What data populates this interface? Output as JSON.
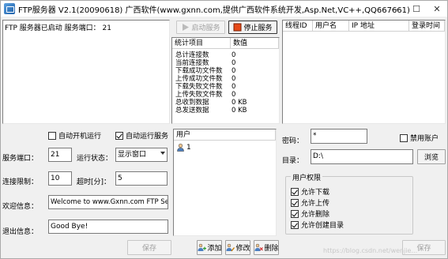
{
  "window": {
    "title": "FTP服务器 V2.1(20090618) 广西软件(www.gxnn.com,提供广西软件系统开发,Asp.Net,VC++,QQ667661)",
    "minimize": "—",
    "maximize": "☐",
    "close": "✕"
  },
  "log": {
    "text": "FTP 服务器已启动 服务端口： 21"
  },
  "toolbar": {
    "start_label": "启动服务",
    "stop_label": "停止服务"
  },
  "stats": {
    "header_item": "统计项目",
    "header_value": "数值",
    "rows": [
      {
        "key": "总计连接数",
        "value": "0"
      },
      {
        "key": "当前连接数",
        "value": "0"
      },
      {
        "key": "下载成功文件数",
        "value": "0"
      },
      {
        "key": "上传成功文件数",
        "value": "0"
      },
      {
        "key": "下载失败文件数",
        "value": "0"
      },
      {
        "key": "上传失败文件数",
        "value": "0"
      },
      {
        "key": "总收到数据",
        "value": "0 KB"
      },
      {
        "key": "总发送数据",
        "value": "0 KB"
      }
    ]
  },
  "threads": {
    "columns": [
      "线程ID",
      "用户名",
      "IP 地址",
      "登录时间"
    ]
  },
  "settings": {
    "autostart_label": "自动开机运行",
    "autorun_label": "自动运行服务",
    "port_label": "服务端口：",
    "port_value": "21",
    "run_state_label": "运行状态：",
    "run_state_value": "显示窗口",
    "conn_limit_label": "连接限制：",
    "conn_limit_value": "10",
    "timeout_label": "超时[分]：",
    "timeout_value": "5",
    "welcome_label": "欢迎信息：",
    "welcome_value": "Welcome to www.Gxnn.com FTP Server!",
    "exit_label": "退出信息：",
    "exit_value": "Good Bye!",
    "save_label": "保存"
  },
  "users": {
    "header": "用户",
    "items": [
      {
        "name": "1"
      }
    ],
    "add_label": "添加",
    "edit_label": "修改",
    "delete_label": "删除"
  },
  "user_detail": {
    "password_label": "密码：",
    "password_value": "*",
    "disable_label": "禁用账户",
    "dir_label": "目录：",
    "dir_value": "D:\\",
    "browse_label": "浏览",
    "perm_title": "用户权限",
    "perms": [
      {
        "label": "允许下载",
        "checked": true
      },
      {
        "label": "允许上传",
        "checked": true
      },
      {
        "label": "允许删除",
        "checked": true
      },
      {
        "label": "允许创建目录",
        "checked": true
      }
    ],
    "save_label": "保存"
  },
  "watermark": "https://blog.csdn.net/wenjie..."
}
